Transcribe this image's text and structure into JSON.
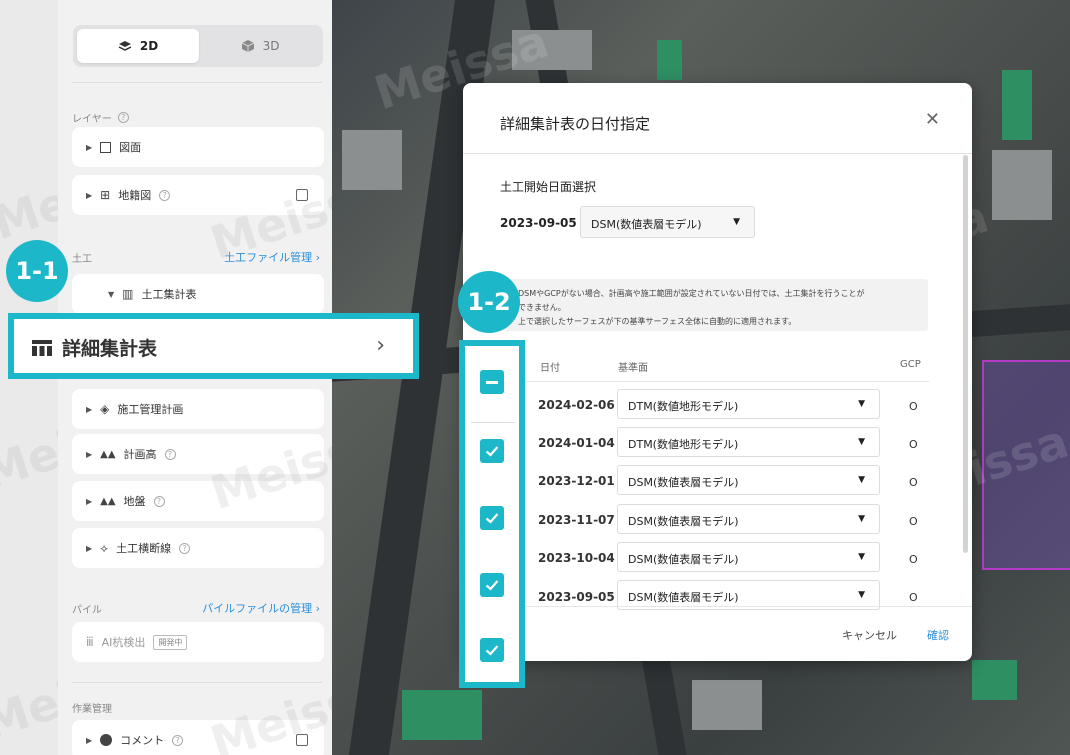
{
  "view_toggle": {
    "label_2d": "2D",
    "label_3d": "3D",
    "active": "2D"
  },
  "layers": {
    "heading": "レイヤー",
    "items": [
      {
        "label": "図面"
      },
      {
        "label": "地籍図"
      }
    ]
  },
  "earthwork": {
    "heading": "土工",
    "manage_link": "土工ファイル管理 ›",
    "summary_label": "土工集計表",
    "detail_label": "詳細集計表",
    "items": [
      {
        "label": "施工管理計画"
      },
      {
        "label": "計画高"
      },
      {
        "label": "地盤"
      },
      {
        "label": "土工横断線"
      }
    ]
  },
  "pile": {
    "heading": "パイル",
    "manage_link": "パイルファイルの管理 ›",
    "ai_label": "AI杭検出",
    "beta_badge": "開発中"
  },
  "work": {
    "heading": "作業管理",
    "comment_label": "コメント"
  },
  "annotations": {
    "badge_1": "1-1",
    "badge_2": "1-2"
  },
  "dialog": {
    "title": "詳細集計表の日付指定",
    "start_label": "土工開始日面選択",
    "start_date": "2023-09-05",
    "start_surface": "DSM(数値表層モデル)",
    "notice_lines": [
      "DSMやGCPがない場合、計画高や施工範囲が設定されていない日付では、土工集計を行うことが",
      "できません。",
      "上で選択したサーフェスが下の基準サーフェス全体に自動的に適用されます。"
    ],
    "headers": {
      "date": "日付",
      "surface": "基準面",
      "gcp": "GCP"
    },
    "rows": [
      {
        "date": "2024-02-06",
        "surface": "DTM(数値地形モデル)",
        "gcp": "O",
        "checked": true
      },
      {
        "date": "2024-01-04",
        "surface": "DTM(数値地形モデル)",
        "gcp": "O",
        "checked": true
      },
      {
        "date": "2023-12-01",
        "surface": "DSM(数値表層モデル)",
        "gcp": "O",
        "checked": false
      },
      {
        "date": "2023-11-07",
        "surface": "DSM(数値表層モデル)",
        "gcp": "O",
        "checked": true
      },
      {
        "date": "2023-10-04",
        "surface": "DSM(数値表層モデル)",
        "gcp": "O",
        "checked": true
      },
      {
        "date": "2023-09-05",
        "surface": "DSM(数値表層モデル)",
        "gcp": "O",
        "checked": true
      }
    ],
    "cancel_label": "キャンセル",
    "confirm_label": "確認"
  },
  "watermark": "Meissa",
  "colors": {
    "accent": "#1cb8c9",
    "link": "#2c8fd9"
  }
}
